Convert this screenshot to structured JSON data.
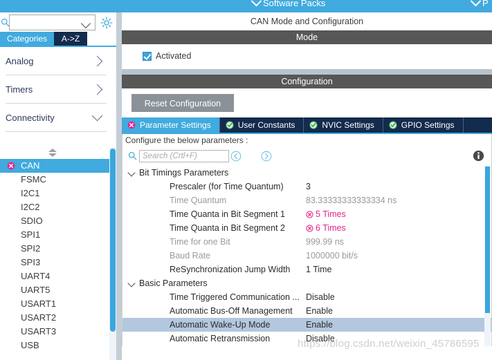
{
  "top_bar": {
    "items": [
      {
        "label": "Software Packs",
        "icon": "chevron-down-icon"
      },
      {
        "label": "P",
        "icon": "chevron-down-icon"
      }
    ]
  },
  "left_panel": {
    "search": {
      "value": "",
      "icon": "search-icon"
    },
    "gear_icon": "gear-icon",
    "tabs": [
      {
        "label": "Categories",
        "active": true
      },
      {
        "label": "A->Z",
        "active": false
      }
    ],
    "categories": [
      {
        "label": "Analog",
        "expanded": false
      },
      {
        "label": "Timers",
        "expanded": false
      },
      {
        "label": "Connectivity",
        "expanded": true
      }
    ],
    "peripherals": [
      {
        "label": "CAN",
        "selected": true,
        "status": "error"
      },
      {
        "label": "FSMC",
        "selected": false,
        "status": "none"
      },
      {
        "label": "I2C1",
        "selected": false,
        "status": "none"
      },
      {
        "label": "I2C2",
        "selected": false,
        "status": "none"
      },
      {
        "label": "SDIO",
        "selected": false,
        "status": "none"
      },
      {
        "label": "SPI1",
        "selected": false,
        "status": "none"
      },
      {
        "label": "SPI2",
        "selected": false,
        "status": "none"
      },
      {
        "label": "SPI3",
        "selected": false,
        "status": "none"
      },
      {
        "label": "UART4",
        "selected": false,
        "status": "none"
      },
      {
        "label": "UART5",
        "selected": false,
        "status": "none"
      },
      {
        "label": "USART1",
        "selected": false,
        "status": "none"
      },
      {
        "label": "USART2",
        "selected": false,
        "status": "none"
      },
      {
        "label": "USART3",
        "selected": false,
        "status": "none"
      },
      {
        "label": "USB",
        "selected": false,
        "status": "none"
      }
    ]
  },
  "right_panel": {
    "title": "CAN Mode and Configuration",
    "mode": {
      "header": "Mode",
      "checkbox": {
        "label": "Activated",
        "checked": true
      }
    },
    "configuration": {
      "header": "Configuration",
      "reset_button": "Reset Configuration",
      "tabs": [
        {
          "label": "Parameter Settings",
          "active": true,
          "status": "error"
        },
        {
          "label": "User Constants",
          "active": false,
          "status": "ok"
        },
        {
          "label": "NVIC Settings",
          "active": false,
          "status": "ok"
        },
        {
          "label": "GPIO Settings",
          "active": false,
          "status": "ok"
        }
      ],
      "configure_hint": "Configure the below parameters :",
      "toolbar": {
        "search_placeholder": "Search (Crtl+F)",
        "search_value": "",
        "search_icon": "search-icon",
        "prev_label": "‹",
        "next_label": "›",
        "info_icon": "info-icon"
      },
      "groups": [
        {
          "label": "Bit Timings Parameters",
          "expanded": true,
          "rows": [
            {
              "name": "Prescaler (for Time Quantum)",
              "value": "3",
              "state": "normal"
            },
            {
              "name": "Time Quantum",
              "value": "83.33333333333334 ns",
              "state": "readonly"
            },
            {
              "name": "Time Quanta in Bit Segment 1",
              "value": "5 Times",
              "state": "warning"
            },
            {
              "name": "Time Quanta in Bit Segment 2",
              "value": "6 Times",
              "state": "warning"
            },
            {
              "name": "Time for one Bit",
              "value": "999.99 ns",
              "state": "readonly"
            },
            {
              "name": "Baud Rate",
              "value": "1000000 bit/s",
              "state": "readonly"
            },
            {
              "name": "ReSynchronization Jump Width",
              "value": "1 Time",
              "state": "normal"
            }
          ]
        },
        {
          "label": "Basic Parameters",
          "expanded": true,
          "rows": [
            {
              "name": "Time Triggered Communication ...",
              "value": "Disable",
              "state": "normal"
            },
            {
              "name": "Automatic Bus-Off Management",
              "value": "Enable",
              "state": "normal"
            },
            {
              "name": "Automatic Wake-Up Mode",
              "value": "Enable",
              "state": "selected"
            },
            {
              "name": "Automatic Retransmission",
              "value": "Disable",
              "state": "normal"
            }
          ]
        }
      ]
    }
  },
  "watermark": "https://blog.csdn.net/weixin_45786595",
  "colors": {
    "accent_blue": "#41aade",
    "dark_navy": "#132b4d",
    "header_gray": "#575757",
    "error_pink": "#e8218a",
    "ok_green": "#2f9e4f",
    "selection_blue": "#b3c7de"
  }
}
